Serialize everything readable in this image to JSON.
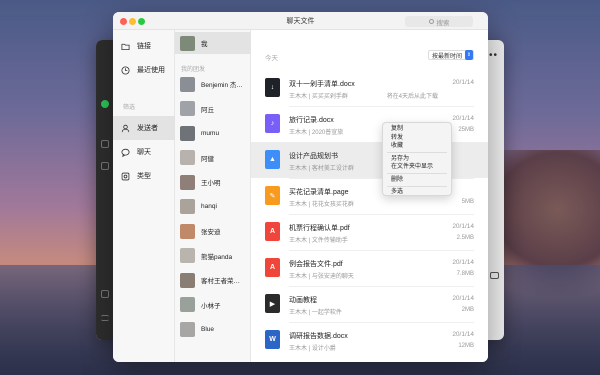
{
  "window": {
    "title": "聊天文件",
    "search_placeholder": "搜索"
  },
  "nav": {
    "items": [
      {
        "label": "链接",
        "icon": "folder-icon"
      },
      {
        "label": "最近使用",
        "icon": "clock-icon"
      }
    ],
    "section_label": "筛选",
    "filters": [
      {
        "label": "发送者",
        "icon": "person-icon",
        "active": true
      },
      {
        "label": "聊天",
        "icon": "chat-bubble-icon"
      },
      {
        "label": "类型",
        "icon": "type-icon"
      }
    ]
  },
  "contacts": {
    "me": "我",
    "section_label": "我的团发",
    "list": [
      {
        "name": "Benjemin 杰…",
        "color": "#8a8f96"
      },
      {
        "name": "阿丘",
        "color": "#9fa3a8"
      },
      {
        "name": "mumu",
        "color": "#6f7378"
      },
      {
        "name": "阿健",
        "color": "#b7b2ad"
      },
      {
        "name": "王小明",
        "color": "#8e7f78"
      },
      {
        "name": "hanqi",
        "color": "#a9a39a"
      },
      {
        "name": "张安迪",
        "color": "#c08a6a"
      },
      {
        "name": "熊猫panda",
        "color": "#b9b4ae"
      },
      {
        "name": "客村王者荣…",
        "color": "#8a7e74"
      },
      {
        "name": "小林子",
        "color": "#9aa19a"
      },
      {
        "name": "Blue",
        "color": "#a8a6a4"
      }
    ],
    "me_color": "#7d8a7a"
  },
  "files": {
    "section_label": "今天",
    "sort_label": "按最新时间",
    "rows": [
      {
        "name": "双十一剁手清单.docx",
        "meta": "王木木 | 买买买剁手群",
        "from": "将在4天后从此下载",
        "date": "20/1/14",
        "size": "",
        "icon": "download-file-icon",
        "icon_color": "#1f2329",
        "glyph": "↓"
      },
      {
        "name": "旅行记录.docx",
        "meta": "王木木 | 2020普宣旅",
        "from": "",
        "date": "20/1/14",
        "size": "25MB",
        "icon": "audio-file-icon",
        "icon_color": "#7a5ef8",
        "glyph": "♪"
      },
      {
        "name": "设计产品规划书",
        "meta": "王木木 | 客村美工设计群",
        "from": "",
        "date": "",
        "size": "",
        "icon": "keynote-file-icon",
        "icon_color": "#3d8ef8",
        "glyph": "▲"
      },
      {
        "name": "买花记录清单.page",
        "meta": "王木木 | 花花女孩买花群",
        "from": "",
        "date": "",
        "size": "5MB",
        "icon": "pages-file-icon",
        "icon_color": "#f79a1e",
        "glyph": "✎"
      },
      {
        "name": "机票行程确认单.pdf",
        "meta": "王木木 | 文件传输助手",
        "from": "",
        "date": "20/1/14",
        "size": "2.5MB",
        "icon": "pdf-file-icon",
        "icon_color": "#f0453a",
        "glyph": "A"
      },
      {
        "name": "例会报告文件.pdf",
        "meta": "王木木 | 与张安迪的聊天",
        "from": "",
        "date": "20/1/14",
        "size": "7.8MB",
        "icon": "pdf-file-icon",
        "icon_color": "#f0453a",
        "glyph": "A"
      },
      {
        "name": "动画教程",
        "meta": "王木木 | 一起学软件",
        "from": "",
        "date": "20/1/14",
        "size": "2MB",
        "icon": "video-file-icon",
        "icon_color": "#2b2b2b",
        "glyph": "▶"
      },
      {
        "name": "调研报告数据.docx",
        "meta": "王木木 | 设计小爵",
        "from": "",
        "date": "20/1/14",
        "size": "12MB",
        "icon": "word-file-icon",
        "icon_color": "#2b66c7",
        "glyph": "W"
      }
    ]
  },
  "context_menu": {
    "group1": [
      "复制",
      "转发",
      "收藏"
    ],
    "group2": [
      "另存为",
      "在文件夹中显示"
    ],
    "group3": [
      "删除"
    ],
    "group4": [
      "多选"
    ]
  }
}
